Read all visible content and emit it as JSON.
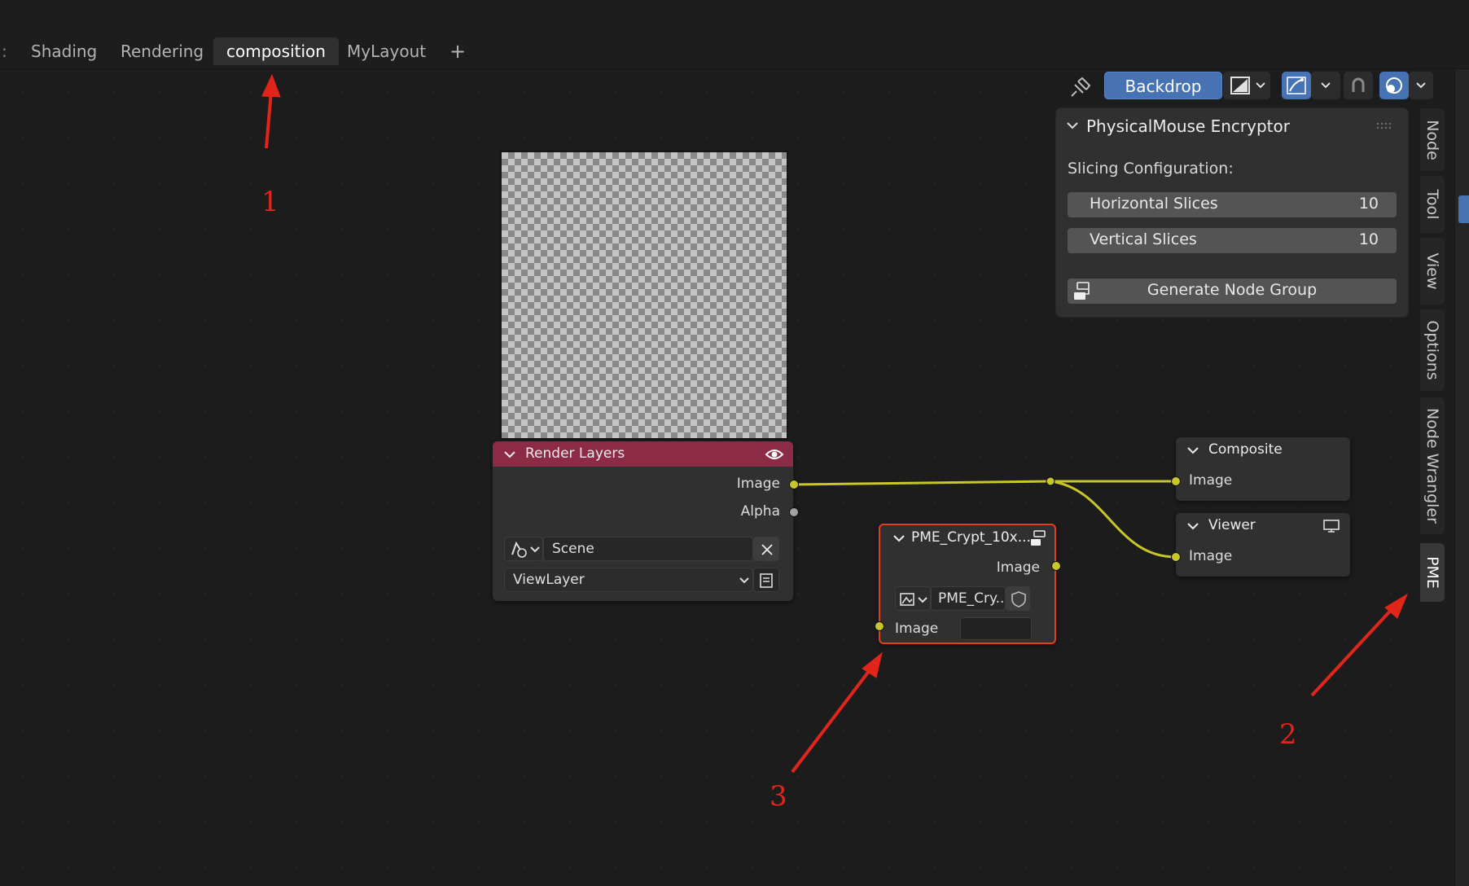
{
  "workspace_tabs": {
    "shading": "Shading",
    "rendering": "Rendering",
    "composition": "composition",
    "mylayout": "MyLayout",
    "add": "+"
  },
  "header": {
    "backdrop_label": "Backdrop"
  },
  "panel": {
    "title": "PhysicalMouse Encryptor",
    "section_label": "Slicing Configuration:",
    "horizontal_label": "Horizontal Slices",
    "horizontal_value": "10",
    "vertical_label": "Vertical Slices",
    "vertical_value": "10",
    "generate_label": "Generate Node Group"
  },
  "sidebar_tabs": {
    "node": "Node",
    "tool": "Tool",
    "view": "View",
    "options": "Options",
    "node_wrangler": "Node Wrangler",
    "pme": "PME"
  },
  "nodes": {
    "render_layers": {
      "title": "Render Layers",
      "output_image": "Image",
      "output_alpha": "Alpha",
      "scene": "Scene",
      "view_layer": "ViewLayer"
    },
    "pme_crypt": {
      "title": "PME_Crypt_10x...",
      "output_image": "Image",
      "group_name": "PME_Cry...",
      "input_image": "Image"
    },
    "composite": {
      "title": "Composite",
      "input_image": "Image"
    },
    "viewer": {
      "title": "Viewer",
      "input_image": "Image"
    }
  },
  "annotations": {
    "a1": "1",
    "a2": "2",
    "a3": "3"
  },
  "colors": {
    "render_layers_header": "#8c2b46",
    "backdrop_active": "#4772b3",
    "link_yellow": "#c7c729",
    "selected_outline": "#e0401e",
    "annotation_red": "#e1251b"
  }
}
